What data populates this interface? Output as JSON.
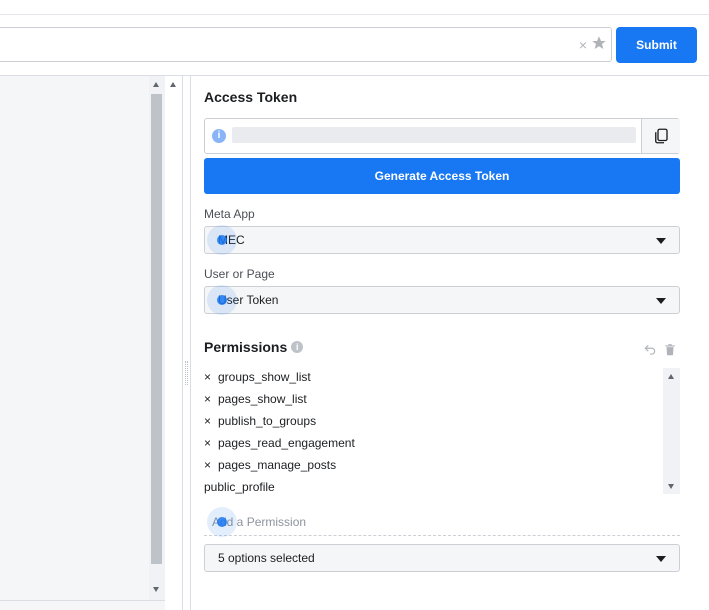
{
  "url_bar": {
    "clear_glyph": "×",
    "star_icon": "star-icon"
  },
  "submit_label": "Submit",
  "access_token": {
    "title": "Access Token",
    "info_icon": "info-icon",
    "copy_icon": "copy-icon",
    "generate_label": "Generate Access Token"
  },
  "meta_app": {
    "label": "Meta App",
    "value": "MEC"
  },
  "user_or_page": {
    "label": "User or Page",
    "value": "User Token"
  },
  "permissions": {
    "title": "Permissions",
    "items": [
      {
        "remove_glyph": "×",
        "name": "groups_show_list"
      },
      {
        "remove_glyph": "×",
        "name": "pages_show_list"
      },
      {
        "remove_glyph": "×",
        "name": "publish_to_groups"
      },
      {
        "remove_glyph": "×",
        "name": "pages_read_engagement"
      },
      {
        "remove_glyph": "×",
        "name": "pages_manage_posts"
      },
      {
        "remove_glyph": "",
        "name": "public_profile"
      }
    ],
    "add_placeholder": "Add a Permission",
    "selected_summary": "5 options selected"
  },
  "colors": {
    "accent": "#1877f2",
    "border": "#ccd0d5",
    "muted": "#8d949e"
  }
}
